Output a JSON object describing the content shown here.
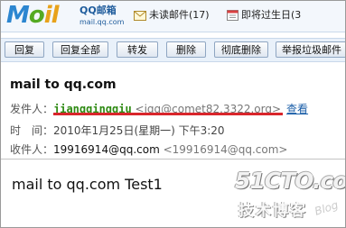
{
  "brand": {
    "logo_letters": [
      "M",
      "o",
      "il"
    ],
    "title": "QQ邮箱",
    "url": "mail.qq.com",
    "colors": {
      "m": "#2c86d0",
      "o": "#55aa22",
      "il": "#e8a21a"
    }
  },
  "notices": {
    "unread": "未读邮件(17)",
    "due": "即将过生日(3",
    "unread_icon": "mail-icon",
    "due_icon": "calendar-icon"
  },
  "toolbar": {
    "reply": "回复",
    "reply_all": "回复全部",
    "forward": "转发",
    "delete": "删除",
    "permanent_delete": "彻底删除",
    "report_spam": "举报垃圾邮件"
  },
  "mail": {
    "subject": "mail to qq.com",
    "from_label": "发件人：",
    "from_name": "jiangqingqiu",
    "from_address": "<jqq@comet82.3322.org>",
    "view_link": "查看",
    "time_label": "时　间：",
    "time_value": "2010年1月25日(星期一) 下午3:20",
    "to_label": "收件人：",
    "to_name": "19916914@qq.com",
    "to_address": "<19916914@qq.com>",
    "body": "mail to qq.com Test1"
  },
  "watermark": {
    "site": "51CTO.com",
    "blog_cn": "技术博客",
    "blog_en": "Blog"
  }
}
